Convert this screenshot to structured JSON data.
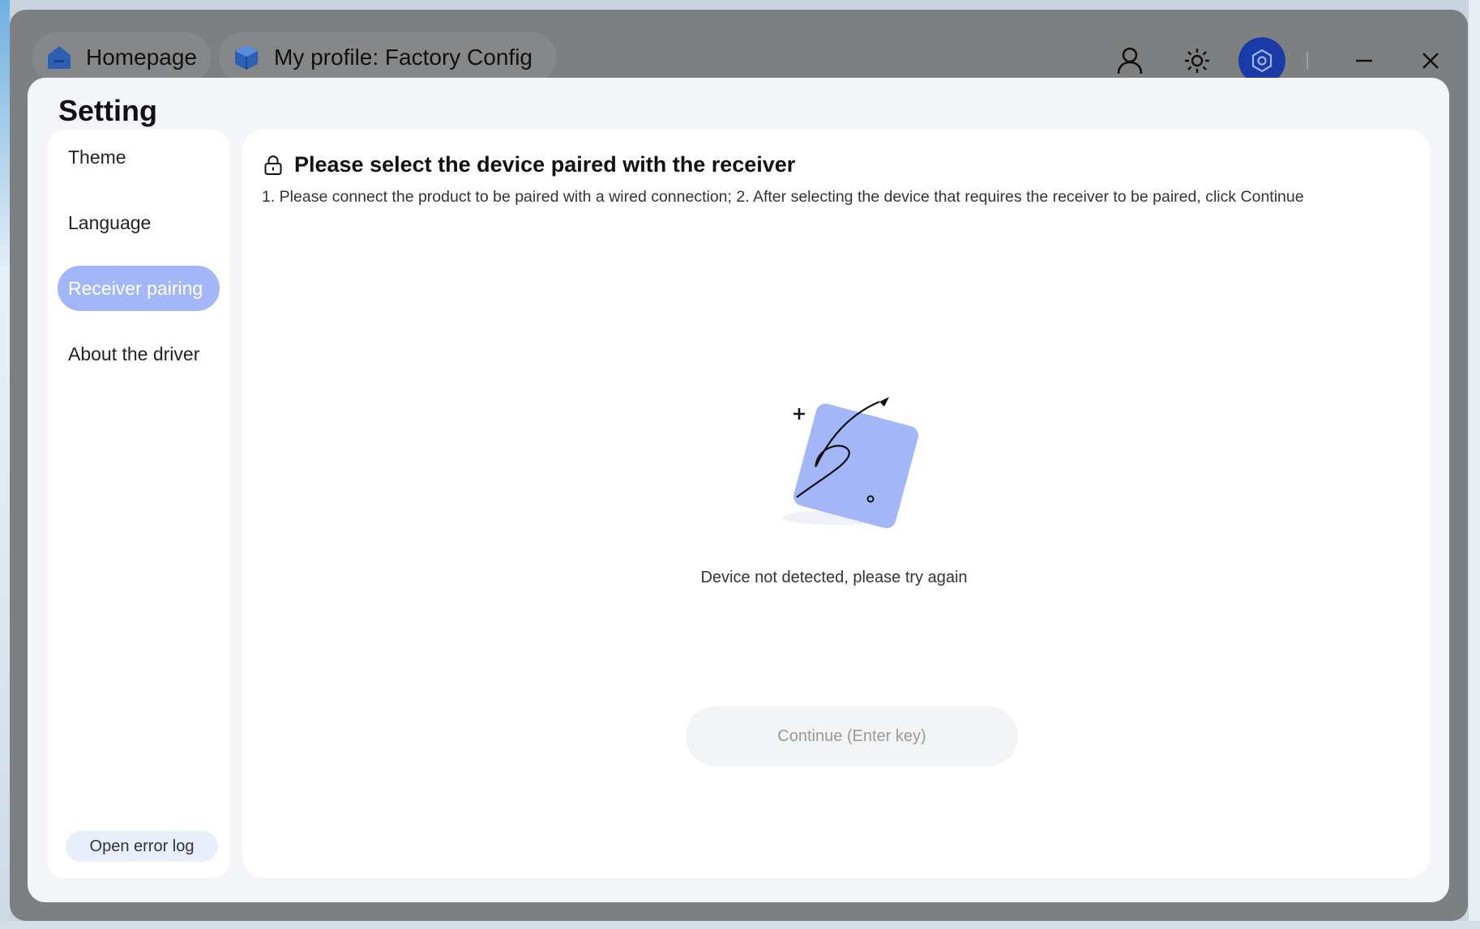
{
  "window": {
    "tabs": [
      {
        "label": "Homepage",
        "icon": "home-icon"
      },
      {
        "label": "My profile: Factory Config",
        "icon": "cube-icon"
      }
    ],
    "toolbar_icons": [
      "user-icon",
      "sun-icon",
      "settings-hex-icon",
      "minimize-icon",
      "close-icon"
    ],
    "accent_color": "#1a3aa8"
  },
  "dialog": {
    "title": "Setting",
    "sidebar": {
      "items": [
        {
          "label": "Theme",
          "active": false
        },
        {
          "label": "Language",
          "active": false
        },
        {
          "label": "Receiver pairing",
          "active": true
        },
        {
          "label": "About the driver",
          "active": false
        }
      ],
      "error_log_label": "Open error log"
    },
    "content": {
      "title": "Please select the device paired with the receiver",
      "title_icon": "lock-icon",
      "description": "1. Please connect the product to be paired with a wired connection; 2. After selecting the device that requires the receiver to be paired, click Continue",
      "empty_message": "Device not detected, please try again",
      "continue_label": "Continue (Enter key)",
      "illustration": "empty-device-illustration"
    }
  }
}
